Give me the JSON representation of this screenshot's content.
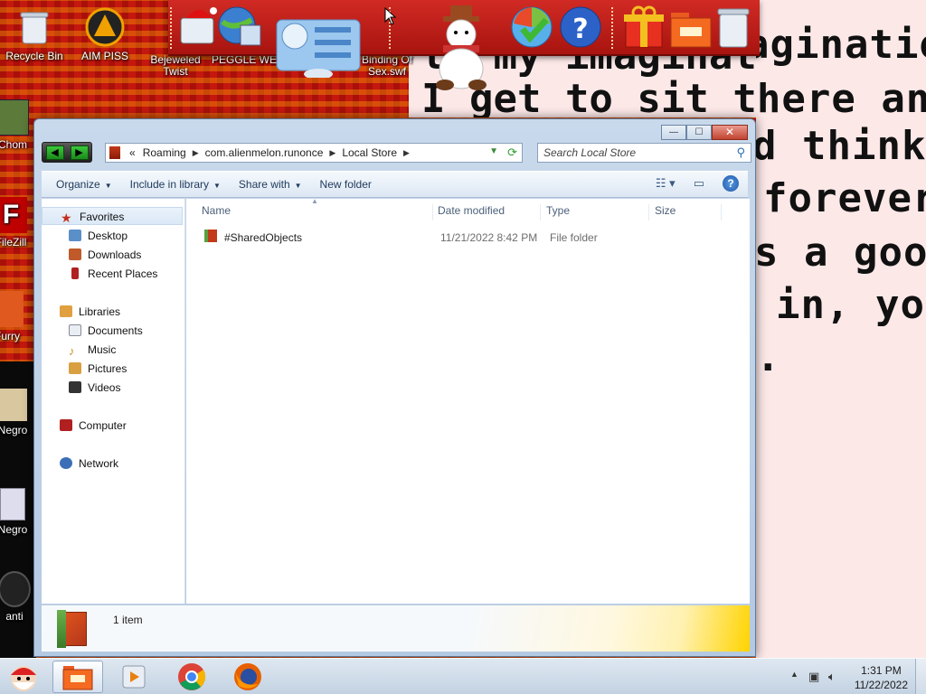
{
  "desktop": {
    "icons": [
      {
        "label": "Recycle Bin"
      },
      {
        "label": "AIM PISS"
      },
      {
        "label": "Bejeweled Twist"
      },
      {
        "label": "PEGGLE WE"
      },
      {
        "label": "Binding Of Sex.swf"
      },
      {
        "label": "Chom"
      },
      {
        "label": "FileZill"
      },
      {
        "label": "Furry"
      },
      {
        "label": "Negro"
      },
      {
        "label": "Negro"
      },
      {
        "label": "anti"
      }
    ],
    "wallpaper_lines": [
      "agination",
      "I get to sit there an",
      "d think",
      "forever",
      "s a goo",
      "in, you",
      "."
    ]
  },
  "window": {
    "caption_buttons": {
      "minimize": "—",
      "maximize": "☐",
      "close": "✕"
    },
    "breadcrumb": [
      "«",
      "Roaming",
      "com.alienmelon.runonce",
      "Local Store"
    ],
    "search_placeholder": "Search Local Store",
    "toolbar": {
      "organize": "Organize",
      "include": "Include in library",
      "share": "Share with",
      "new_folder": "New folder"
    },
    "nav": {
      "favorites": "Favorites",
      "fav_items": [
        "Desktop",
        "Downloads",
        "Recent Places"
      ],
      "libraries": "Libraries",
      "lib_items": [
        "Documents",
        "Music",
        "Pictures",
        "Videos"
      ],
      "computer": "Computer",
      "network": "Network"
    },
    "columns": [
      "Name",
      "Date modified",
      "Type",
      "Size"
    ],
    "files": [
      {
        "name": "#SharedObjects",
        "date": "11/21/2022 8:42 PM",
        "type": "File folder",
        "size": ""
      }
    ],
    "status": "1 item"
  },
  "taskbar": {
    "time": "1:31 PM",
    "date": "11/22/2022"
  },
  "colors": {
    "wallpaper_red": "#c4180f",
    "dock_red": "#d12a24",
    "folder_red": "#c23a1a"
  }
}
